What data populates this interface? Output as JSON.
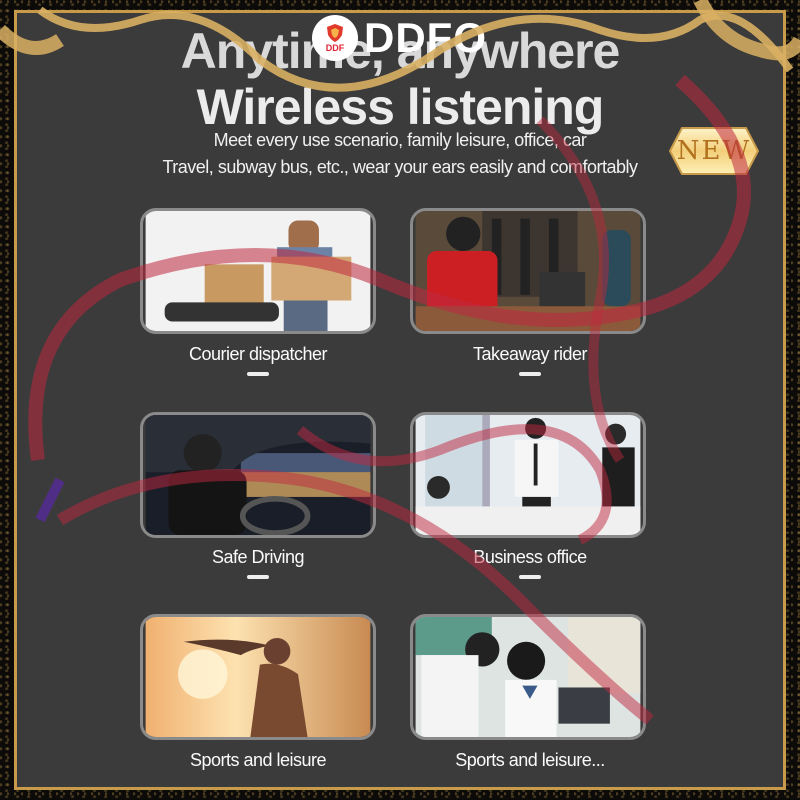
{
  "brand": {
    "name": "DDFO",
    "badge": "DDF"
  },
  "headline": {
    "line1": "Anytime, anywhere",
    "line2": "Wireless listening"
  },
  "subtitle": {
    "line1": "Meet every use scenario, family leisure, office, car",
    "line2": "Travel, subway bus, etc., wear your ears easily and comfortably"
  },
  "badge": {
    "text": "NEW"
  },
  "scenarios": [
    {
      "label": "Courier dispatcher"
    },
    {
      "label": "Takeaway rider"
    },
    {
      "label": "Safe Driving"
    },
    {
      "label": "Business office"
    },
    {
      "label": "Sports and leisure"
    },
    {
      "label": "Sports and leisure..."
    }
  ],
  "colors": {
    "frame": "#c79b4a",
    "panel": "#3b3b3b",
    "ribbon": "#c0283f",
    "text": "#f0f0f0"
  }
}
